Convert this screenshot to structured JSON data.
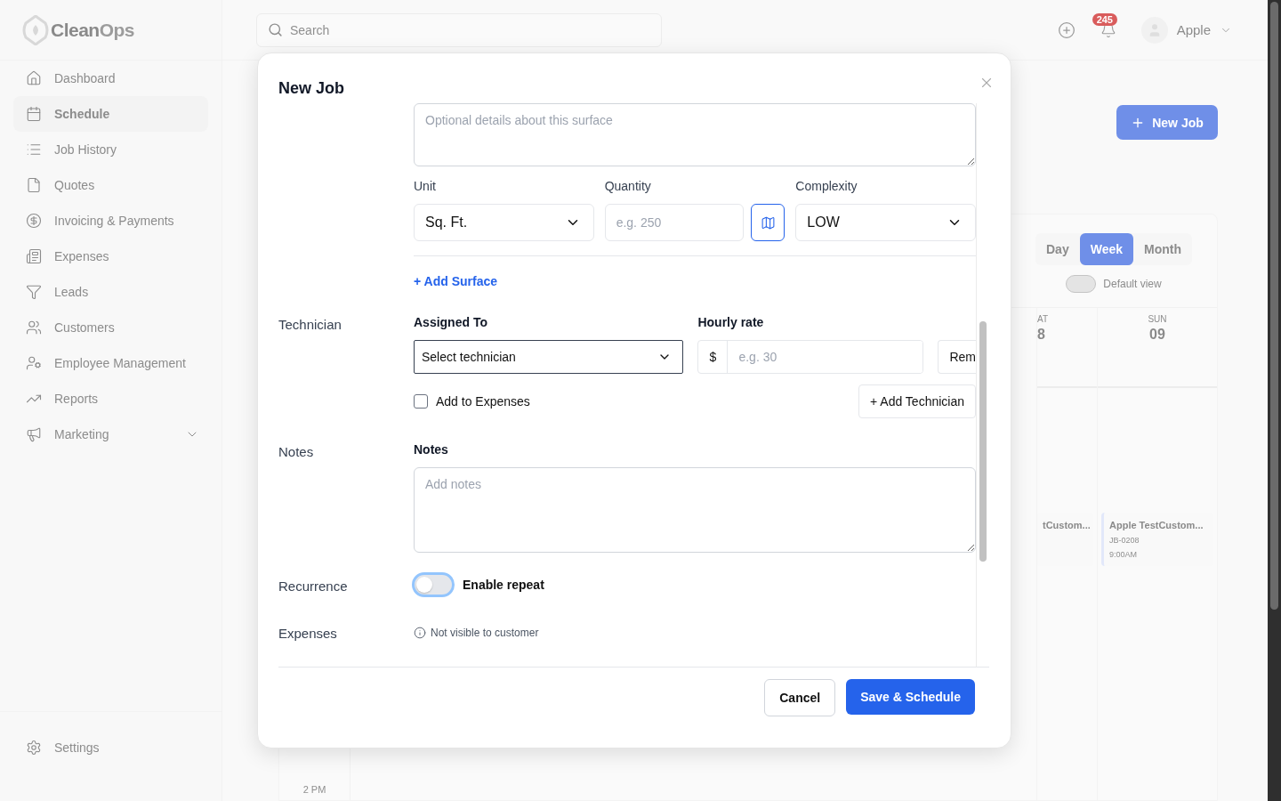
{
  "logo": {
    "part1": "Clean",
    "part2": "Ops"
  },
  "sidebar": {
    "items": [
      {
        "label": "Dashboard",
        "selected": false
      },
      {
        "label": "Schedule",
        "selected": true
      },
      {
        "label": "Job History",
        "selected": false
      },
      {
        "label": "Quotes",
        "selected": false
      },
      {
        "label": "Invoicing & Payments",
        "selected": false
      },
      {
        "label": "Expenses",
        "selected": false
      },
      {
        "label": "Leads",
        "selected": false
      },
      {
        "label": "Customers",
        "selected": false
      },
      {
        "label": "Employee Management",
        "selected": false
      },
      {
        "label": "Reports",
        "selected": false
      },
      {
        "label": "Marketing",
        "selected": false,
        "expandable": true
      }
    ],
    "settings": "Settings"
  },
  "topbar": {
    "search": {
      "placeholder": "Search"
    },
    "notifications": "245",
    "user": "Apple"
  },
  "page": {
    "new_job": "New Job",
    "views": [
      {
        "label": "Day",
        "selected": false
      },
      {
        "label": "Week",
        "selected": true
      },
      {
        "label": "Month",
        "selected": false
      }
    ],
    "default_view": {
      "label": "Default view",
      "on": false
    },
    "days": [
      {
        "label": "AT",
        "date": "8"
      },
      {
        "label": "SUN",
        "date": "09"
      }
    ],
    "events": [
      {
        "title": "tCustom..."
      },
      {
        "title": "Apple TestCustom...",
        "id": "JB-0208",
        "time": "9:00AM"
      }
    ],
    "time_label": "2 PM"
  },
  "modal": {
    "title": "New Job",
    "surface": {
      "description_placeholder": "Optional details about this surface",
      "unit": {
        "label": "Unit",
        "value": "Sq. Ft."
      },
      "quantity": {
        "label": "Quantity",
        "placeholder": "e.g. 250"
      },
      "complexity": {
        "label": "Complexity",
        "value": "LOW"
      },
      "add_surface": "+ Add Surface"
    },
    "technician": {
      "section": "Technician",
      "assigned_label": "Assigned To",
      "assigned_value": "Select technician",
      "rate_label": "Hourly rate",
      "currency": "$",
      "rate_placeholder": "e.g. 30",
      "remove": "Rem",
      "add_to_expenses": {
        "label": "Add to Expenses",
        "checked": false
      },
      "add_technician": "+ Add Technician"
    },
    "notes": {
      "section": "Notes",
      "label": "Notes",
      "placeholder": "Add notes"
    },
    "recurrence": {
      "section": "Recurrence",
      "label": "Enable repeat",
      "on": false
    },
    "expenses": {
      "section": "Expenses",
      "hint": "Not visible to customer"
    },
    "buttons": {
      "cancel": "Cancel",
      "save": "Save & Schedule"
    }
  }
}
